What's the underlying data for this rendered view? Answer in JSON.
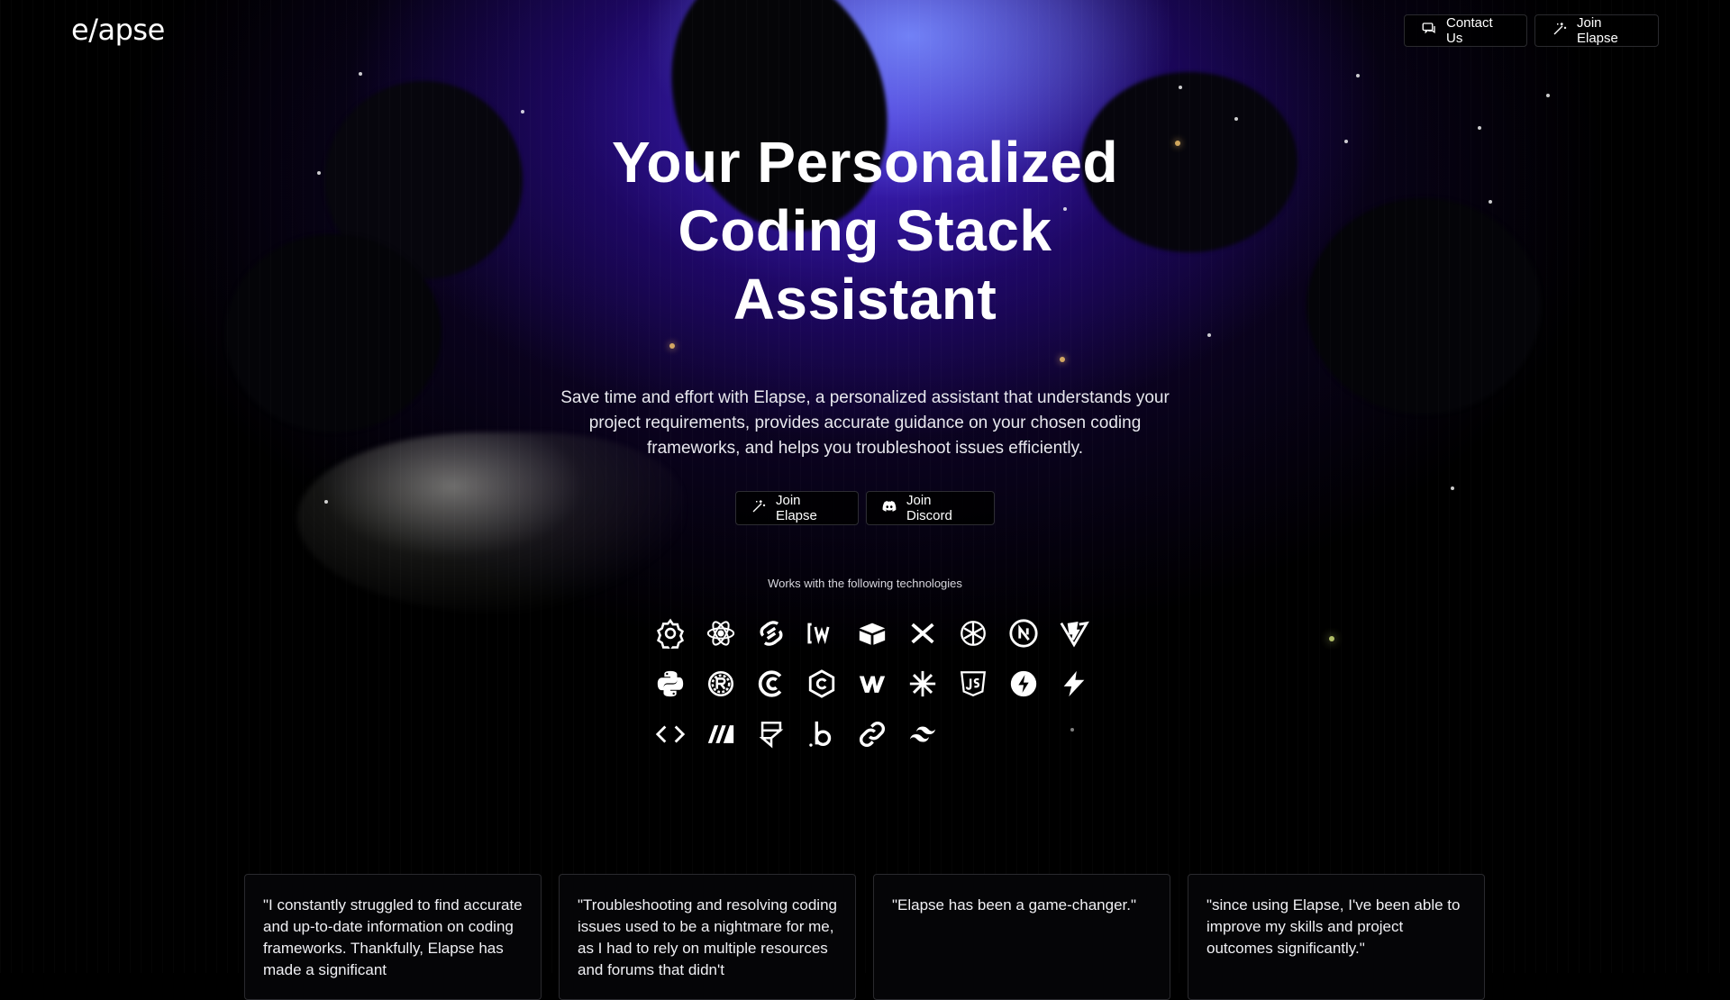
{
  "brand": {
    "logo_text": "e/apse"
  },
  "nav": {
    "contact_label": "Contact Us",
    "contact_icon": "chat-bubbles-icon",
    "join_label": "Join Elapse",
    "join_icon": "magic-wand-icon"
  },
  "hero": {
    "title_line1": "Your Personalized",
    "title_line2": "Coding Stack",
    "title_line3": "Assistant",
    "subtitle": "Save time and effort with Elapse, a personalized assistant that understands your project requirements, provides accurate guidance on your chosen coding frameworks, and helps you troubleshoot issues efficiently.",
    "cta_join_label": "Join Elapse",
    "cta_join_icon": "magic-wand-icon",
    "cta_discord_label": "Join Discord",
    "cta_discord_icon": "discord-icon"
  },
  "technologies": {
    "label": "Works with the following technologies",
    "icons": [
      "openai-gear-icon",
      "react-icon",
      "svelte-icon",
      "windi-icon",
      "prismic-icon",
      "x-icon",
      "openai-icon",
      "nextjs-icon",
      "vite-icon",
      "python-icon",
      "rust-icon",
      "clojure-icon",
      "csharp-icon",
      "webflow-icon",
      "asterisk-icon",
      "javascript-icon",
      "lightning-circle-icon",
      "bolt-icon",
      "code-brackets-icon",
      "mantine-icon",
      "framer-icon",
      "bun-icon",
      "link-icon",
      "tailwind-icon"
    ]
  },
  "testimonials": [
    {
      "text": "\"I constantly struggled to find accurate and up-to-date information on coding frameworks. Thankfully, Elapse has made a significant"
    },
    {
      "text": "\"Troubleshooting and resolving coding issues used to be a nightmare for me, as I had to rely on multiple resources and forums that didn't"
    },
    {
      "text": "\"Elapse has been a game-changer.\""
    },
    {
      "text": "\"since using Elapse, I've been able to improve my skills and project outcomes significantly.\""
    }
  ],
  "colors": {
    "background": "#000000",
    "glow_primary": "#4628dc",
    "glow_highlight": "#788cff",
    "text": "#ffffff",
    "border": "#2a2a2e"
  }
}
